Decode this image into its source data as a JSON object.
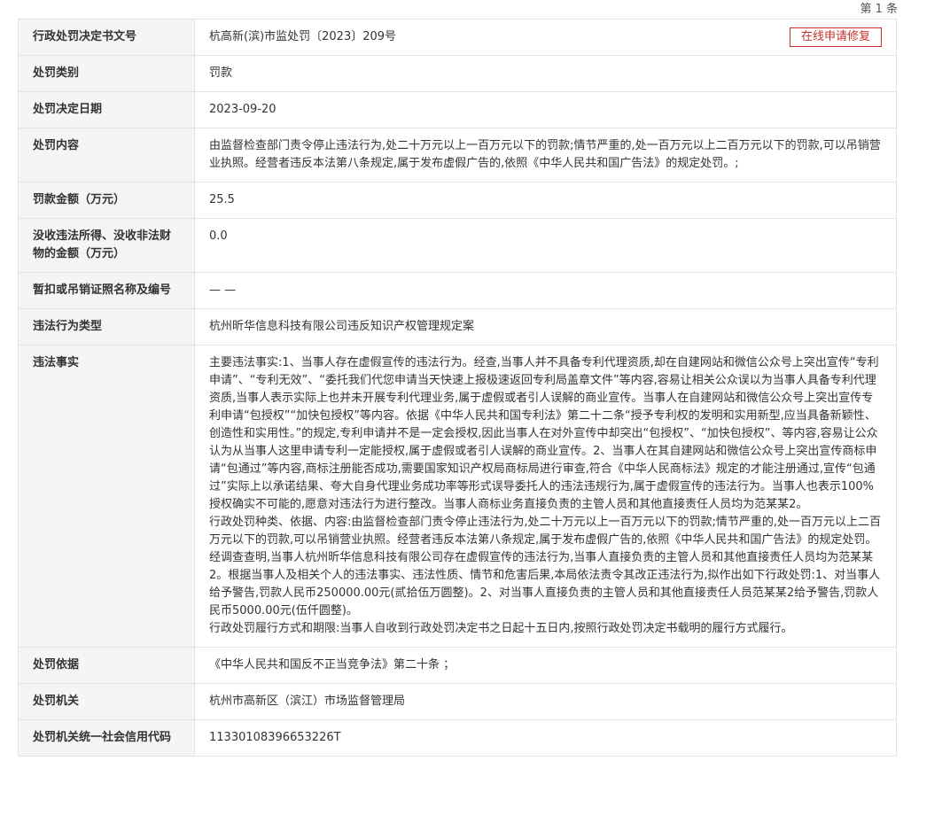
{
  "page_count_label": "第 1 条",
  "repair_button_label": "在线申请修复",
  "rows": [
    {
      "label": "行政处罚决定书文号",
      "value": "杭高新(滨)市监处罚〔2023〕209号"
    },
    {
      "label": "处罚类别",
      "value": "罚款"
    },
    {
      "label": "处罚决定日期",
      "value": "2023-09-20"
    },
    {
      "label": "处罚内容",
      "value": "由监督检查部门责令停止违法行为,处二十万元以上一百万元以下的罚款;情节严重的,处一百万元以上二百万元以下的罚款,可以吊销营业执照。经营者违反本法第八条规定,属于发布虚假广告的,依照《中华人民共和国广告法》的规定处罚。;"
    },
    {
      "label": "罚款金额（万元）",
      "value": "25.5"
    },
    {
      "label": "没收违法所得、没收非法财物的金额（万元）",
      "value": "0.0"
    },
    {
      "label": "暂扣或吊销证照名称及编号",
      "value": "— —"
    },
    {
      "label": "违法行为类型",
      "value": "杭州昕华信息科技有限公司违反知识产权管理规定案"
    },
    {
      "label": "违法事实",
      "paragraphs": [
        "主要违法事实:1、当事人存在虚假宣传的违法行为。经查,当事人并不具备专利代理资质,却在自建网站和微信公众号上突出宣传“专利申请”、“专利无效”、“委托我们代您申请当天快速上报极速返回专利局盖章文件”等内容,容易让相关公众误以为当事人具备专利代理资质,当事人表示实际上也并未开展专利代理业务,属于虚假或者引人误解的商业宣传。当事人在自建网站和微信公众号上突出宣传专利申请“包授权”“加快包授权”等内容。依据《中华人民共和国专利法》第二十二条“授予专利权的发明和实用新型,应当具备新颖性、创造性和实用性。”的规定,专利申请并不是一定会授权,因此当事人在对外宣传中却突出“包授权”、“加快包授权”、等内容,容易让公众认为从当事人这里申请专利一定能授权,属于虚假或者引人误解的商业宣传。2、当事人在其自建网站和微信公众号上突出宣传商标申请“包通过”等内容,商标注册能否成功,需要国家知识产权局商标局进行审查,符合《中华人民商标法》规定的才能注册通过,宣传“包通过”实际上以承诺结果、夸大自身代理业务成功率等形式误导委托人的违法违规行为,属于虚假宣传的违法行为。当事人也表示100%授权确实不可能的,愿意对违法行为进行整改。当事人商标业务直接负责的主管人员和其他直接责任人员均为范某某2。",
        "行政处罚种类、依据、内容:由监督检查部门责令停止违法行为,处二十万元以上一百万元以下的罚款;情节严重的,处一百万元以上二百万元以下的罚款,可以吊销营业执照。经营者违反本法第八条规定,属于发布虚假广告的,依照《中华人民共和国广告法》的规定处罚。经调查查明,当事人杭州昕华信息科技有限公司存在虚假宣传的违法行为,当事人直接负责的主管人员和其他直接责任人员均为范某某2。根据当事人及相关个人的违法事实、违法性质、情节和危害后果,本局依法责令其改正违法行为,拟作出如下行政处罚:1、对当事人给予警告,罚款人民币250000.00元(贰拾伍万圆整)。2、对当事人直接负责的主管人员和其他直接责任人员范某某2给予警告,罚款人民币5000.00元(伍仟圆整)。",
        "行政处罚履行方式和期限:当事人自收到行政处罚决定书之日起十五日内,按照行政处罚决定书载明的履行方式履行。"
      ]
    },
    {
      "label": "处罚依据",
      "value": "《中华人民共和国反不正当竞争法》第二十条  ；"
    },
    {
      "label": "处罚机关",
      "value": "杭州市高新区（滨江）市场监督管理局"
    },
    {
      "label": "处罚机关统一社会信用代码",
      "value": "11330108396653226T"
    }
  ]
}
